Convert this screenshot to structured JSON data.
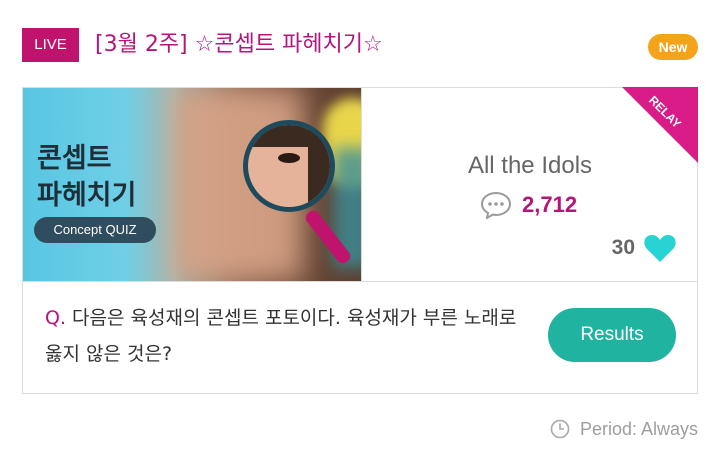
{
  "header": {
    "live_label": "LIVE",
    "title": "[3월 2주] ☆콘셉트 파헤치기☆",
    "new_label": "New"
  },
  "thumbnail": {
    "text": "콘셉트\n파헤치기",
    "quiz_label": "Concept QUIZ"
  },
  "info": {
    "relay_label": "RELAY",
    "publisher": "All the Idols",
    "comment_count": "2,712",
    "like_count": "30"
  },
  "question": {
    "prefix": "Q.",
    "text": " 다음은 육성재의 콘셉트 포토이다. 육성재가 부른 노래로 옳지 않은 것은?"
  },
  "results_button": "Results",
  "period": "Period: Always",
  "colors": {
    "accent": "#b5157a",
    "live": "#c0136d",
    "new": "#f4a31a",
    "relay": "#d81b86",
    "results": "#1fb3a0",
    "heart": "#27d3d3"
  },
  "icons": [
    "comment-icon",
    "heart-icon",
    "clock-icon",
    "magnifier-icon"
  ]
}
